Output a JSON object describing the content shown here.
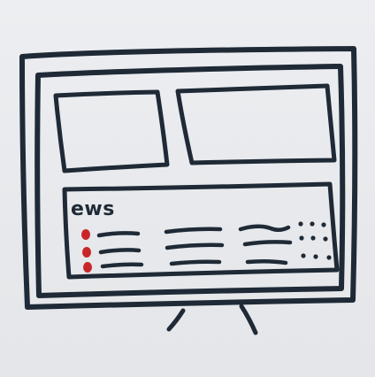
{
  "sketch": {
    "panel_title": "ews",
    "colors": {
      "ink": "#1f2a36",
      "accent": "#c9262a",
      "paper": "#e9eaed"
    },
    "table": {
      "row_count": 3,
      "columns": [
        "status-dot",
        "text-line",
        "text-line",
        "text-line",
        "dot-grid"
      ],
      "row_markers": [
        "red-dot",
        "red-dot",
        "red-dot"
      ]
    }
  }
}
